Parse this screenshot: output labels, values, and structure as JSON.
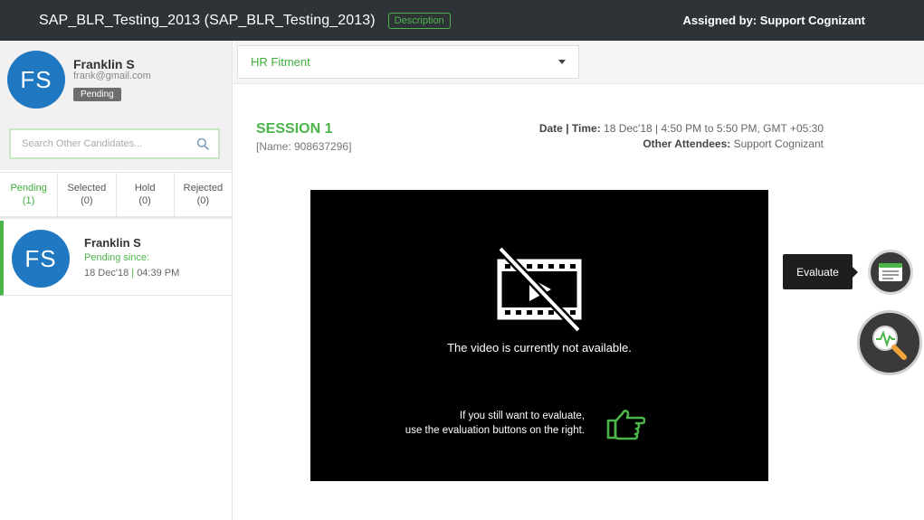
{
  "header": {
    "title": "SAP_BLR_Testing_2013 (SAP_BLR_Testing_2013)",
    "description_label": "Description",
    "assigned_by": "Assigned by: Support Cognizant"
  },
  "profile": {
    "initials": "FS",
    "name": "Franklin S",
    "email": "frank@gmail.com",
    "status": "Pending"
  },
  "search": {
    "placeholder": "Search Other Candidates...",
    "value": ""
  },
  "tabs": [
    {
      "label": "Pending",
      "count": "(1)"
    },
    {
      "label": "Selected",
      "count": "(0)"
    },
    {
      "label": "Hold",
      "count": "(0)"
    },
    {
      "label": "Rejected",
      "count": "(0)"
    }
  ],
  "candidates": [
    {
      "initials": "FS",
      "name": "Franklin S",
      "status": "Pending since:",
      "date": "18 Dec'18",
      "separator": "|",
      "time": "04:39 PM"
    }
  ],
  "round_select": {
    "value": "HR Fitment"
  },
  "session": {
    "title": "SESSION 1",
    "name": "[Name: 908637296]",
    "datetime_label": "Date | Time:",
    "datetime_value": "18 Dec'18 | 4:50 PM to 5:50 PM, GMT +05:30",
    "attendees_label": "Other Attendees:",
    "attendees_value": "Support Cognizant"
  },
  "video": {
    "message": "The video is currently not available.",
    "hint_line1": "If you still want to evaluate,",
    "hint_line2": "use the evaluation buttons on the right.",
    "icons": [
      "video-off-icon",
      "thumb-pointing-right-icon"
    ]
  },
  "actions": {
    "evaluate_tooltip": "Evaluate",
    "icons": [
      "evaluate-form-icon",
      "analyze-magnifier-icon"
    ]
  },
  "colors": {
    "accent": "#4cb54a",
    "header_bg": "#2e3338",
    "avatar_bg": "#1f78c1"
  }
}
